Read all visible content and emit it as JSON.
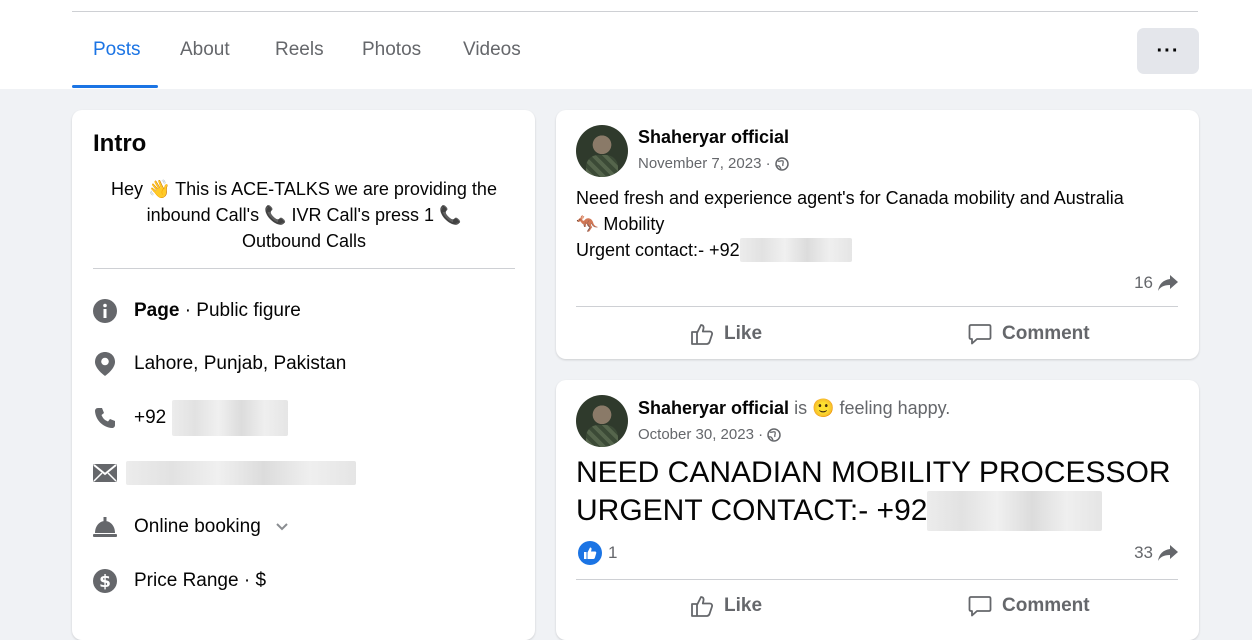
{
  "tabs": [
    {
      "label": "Posts",
      "active": true
    },
    {
      "label": "About"
    },
    {
      "label": "Reels"
    },
    {
      "label": "Photos"
    },
    {
      "label": "Videos"
    }
  ],
  "more_button": "···",
  "intro": {
    "title": "Intro",
    "bio_line1": "Hey 👋 This is ACE-TALKS we are providing the",
    "bio_line2": "inbound Call's 📞 IVR Call's press 1 📞",
    "bio_line3": "Outbound Calls",
    "page_label": "Page",
    "page_category": " · Public figure",
    "location": "Lahore, Punjab, Pakistan",
    "phone_prefix": "+92",
    "booking": "Online booking",
    "price_range": "Price Range · $",
    "icons": [
      "info-icon",
      "location-icon",
      "phone-icon",
      "mail-icon",
      "bell-icon",
      "dollar-icon"
    ]
  },
  "posts": [
    {
      "author": "Shaheryar official",
      "date": "November 7, 2023 ·",
      "text_line1": "Need fresh and experience agent's for Canada mobility and Australia",
      "text_line2": "🦘 Mobility",
      "text_line3": "Urgent contact:- +92",
      "shares": "16",
      "like": "Like",
      "comment": "Comment"
    },
    {
      "author": "Shaheryar official",
      "feeling_is": "is",
      "feeling_emoji": "🙂",
      "feeling_text": "feeling happy.",
      "date": "October 30, 2023 ·",
      "big_line1": "NEED CANADIAN MOBILITY PROCESSOR",
      "big_line2": "URGENT CONTACT:- +92",
      "reactions": "1",
      "shares": "33",
      "like": "Like",
      "comment": "Comment"
    }
  ],
  "colors": {
    "accent": "#1b74e4",
    "secondary_text": "#65676b",
    "background": "#f0f2f5"
  }
}
